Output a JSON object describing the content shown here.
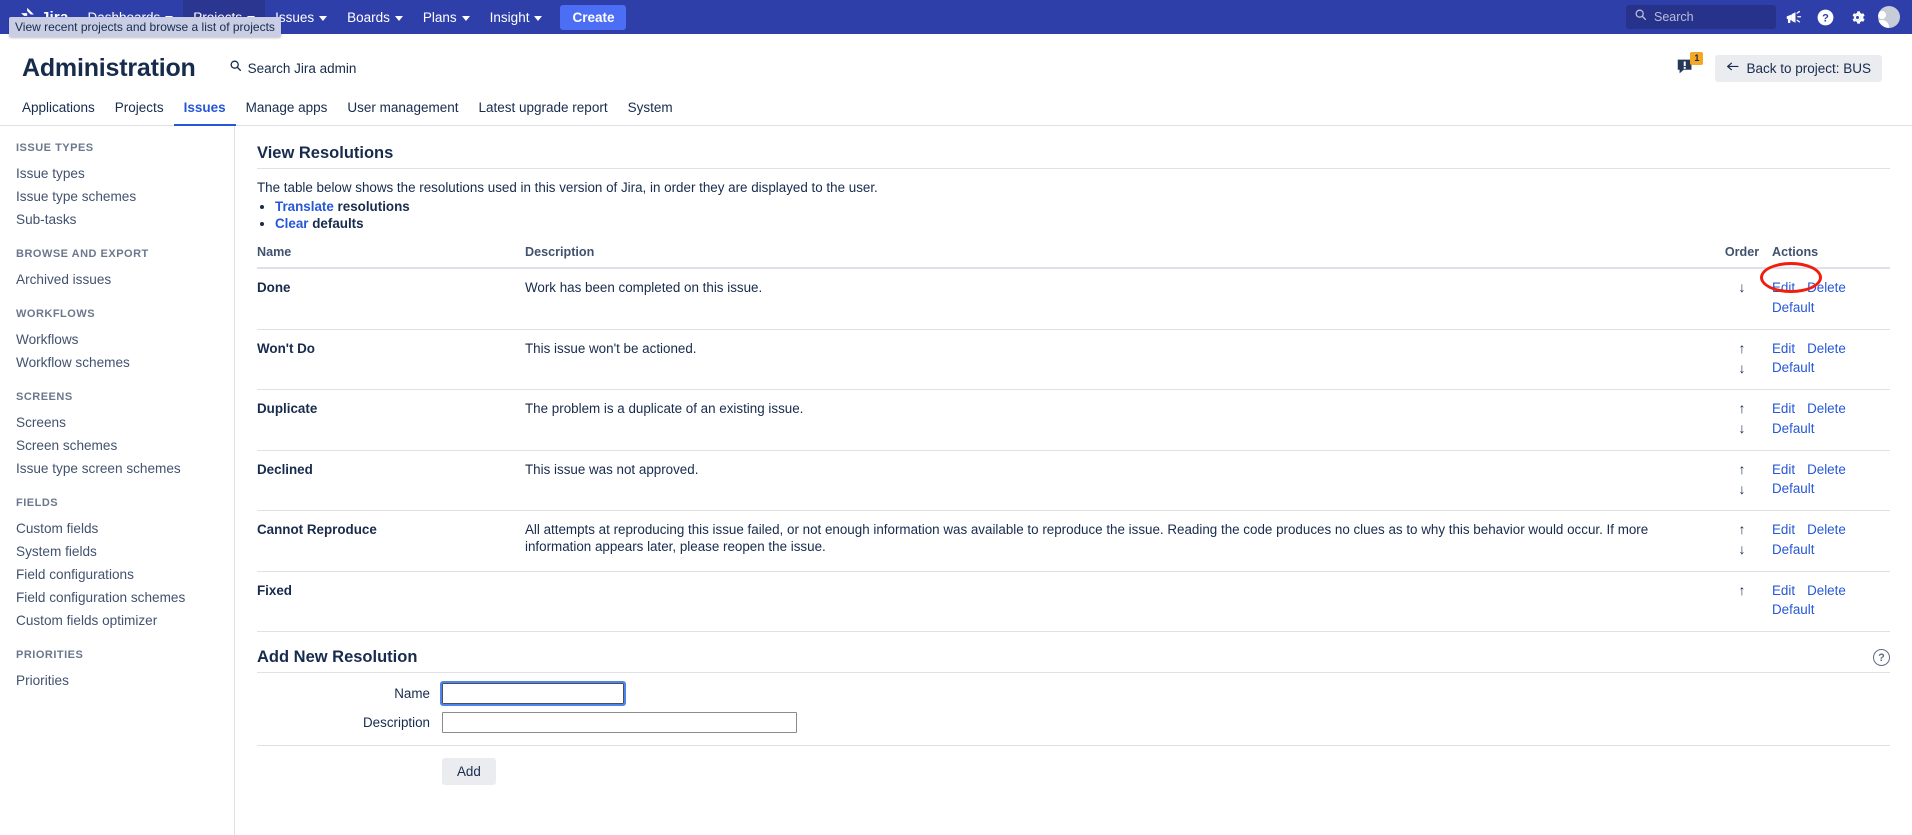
{
  "topnav": {
    "logo_text": "Jira",
    "items": [
      {
        "label": "Dashboards",
        "has_caret": true,
        "hover": false
      },
      {
        "label": "Projects",
        "has_caret": true,
        "hover": true
      },
      {
        "label": "Issues",
        "has_caret": true,
        "hover": false
      },
      {
        "label": "Boards",
        "has_caret": true,
        "hover": false
      },
      {
        "label": "Plans",
        "has_caret": true,
        "hover": false
      },
      {
        "label": "Insight",
        "has_caret": true,
        "hover": false
      }
    ],
    "create_label": "Create",
    "search_placeholder": "Search",
    "tooltip": "View recent projects and browse a list of projects",
    "icons": [
      "announcement-icon",
      "help-icon",
      "settings-icon",
      "avatar"
    ],
    "colors": {
      "bar": "#2f3faa",
      "create": "#4c6ef5",
      "search_field": "#27338a"
    }
  },
  "admin_header": {
    "title": "Administration",
    "search_placeholder": "Search Jira admin",
    "notification_badge": "1",
    "back_button_label": "Back to project: BUS"
  },
  "admin_tabs": {
    "items": [
      {
        "label": "Applications",
        "active": false
      },
      {
        "label": "Projects",
        "active": false
      },
      {
        "label": "Issues",
        "active": true
      },
      {
        "label": "Manage apps",
        "active": false
      },
      {
        "label": "User management",
        "active": false
      },
      {
        "label": "Latest upgrade report",
        "active": false
      },
      {
        "label": "System",
        "active": false
      }
    ],
    "accent": "#2557d6"
  },
  "sidebar": {
    "groups": [
      {
        "title": "ISSUE TYPES",
        "links": [
          "Issue types",
          "Issue type schemes",
          "Sub-tasks"
        ]
      },
      {
        "title": "BROWSE AND EXPORT",
        "links": [
          "Archived issues"
        ]
      },
      {
        "title": "WORKFLOWS",
        "links": [
          "Workflows",
          "Workflow schemes"
        ]
      },
      {
        "title": "SCREENS",
        "links": [
          "Screens",
          "Screen schemes",
          "Issue type screen schemes"
        ]
      },
      {
        "title": "FIELDS",
        "links": [
          "Custom fields",
          "System fields",
          "Field configurations",
          "Field configuration schemes",
          "Custom fields optimizer"
        ]
      },
      {
        "title": "PRIORITIES",
        "links": [
          "Priorities"
        ]
      }
    ]
  },
  "main": {
    "section_title": "View Resolutions",
    "intro_text": "The table below shows the resolutions used in this version of Jira, in order they are displayed to the user.",
    "bullets": [
      {
        "link": "Translate",
        "rest": "resolutions"
      },
      {
        "link": "Clear",
        "rest": "defaults"
      }
    ],
    "table": {
      "headers": [
        "Name",
        "Description",
        "Order",
        "Actions"
      ],
      "rows": [
        {
          "name": "Done",
          "description": "Work has been completed on this issue.",
          "order": [
            "down"
          ],
          "actions": [
            "Edit",
            "Delete",
            "Default"
          ],
          "annotated": true
        },
        {
          "name": "Won't Do",
          "description": "This issue won't be actioned.",
          "order": [
            "up",
            "down"
          ],
          "actions": [
            "Edit",
            "Delete",
            "Default"
          ],
          "annotated": false
        },
        {
          "name": "Duplicate",
          "description": "The problem is a duplicate of an existing issue.",
          "order": [
            "up",
            "down"
          ],
          "actions": [
            "Edit",
            "Delete",
            "Default"
          ],
          "annotated": false
        },
        {
          "name": "Declined",
          "description": "This issue was not approved.",
          "order": [
            "up",
            "down"
          ],
          "actions": [
            "Edit",
            "Delete",
            "Default"
          ],
          "annotated": false
        },
        {
          "name": "Cannot Reproduce",
          "description": "All attempts at reproducing this issue failed, or not enough information was available to reproduce the issue. Reading the code produces no clues as to why this behavior would occur. If more information appears later, please reopen the issue.",
          "order": [
            "up",
            "down"
          ],
          "actions": [
            "Edit",
            "Delete",
            "Default"
          ],
          "annotated": false
        },
        {
          "name": "Fixed",
          "description": "",
          "order": [
            "up"
          ],
          "actions": [
            "Edit",
            "Delete",
            "Default"
          ],
          "annotated": false
        }
      ]
    },
    "add_form": {
      "title": "Add New Resolution",
      "name_label": "Name",
      "name_value": "",
      "description_label": "Description",
      "description_value": "",
      "submit_label": "Add",
      "help_glyph": "?"
    },
    "annotation_color": "#f01e0f"
  }
}
